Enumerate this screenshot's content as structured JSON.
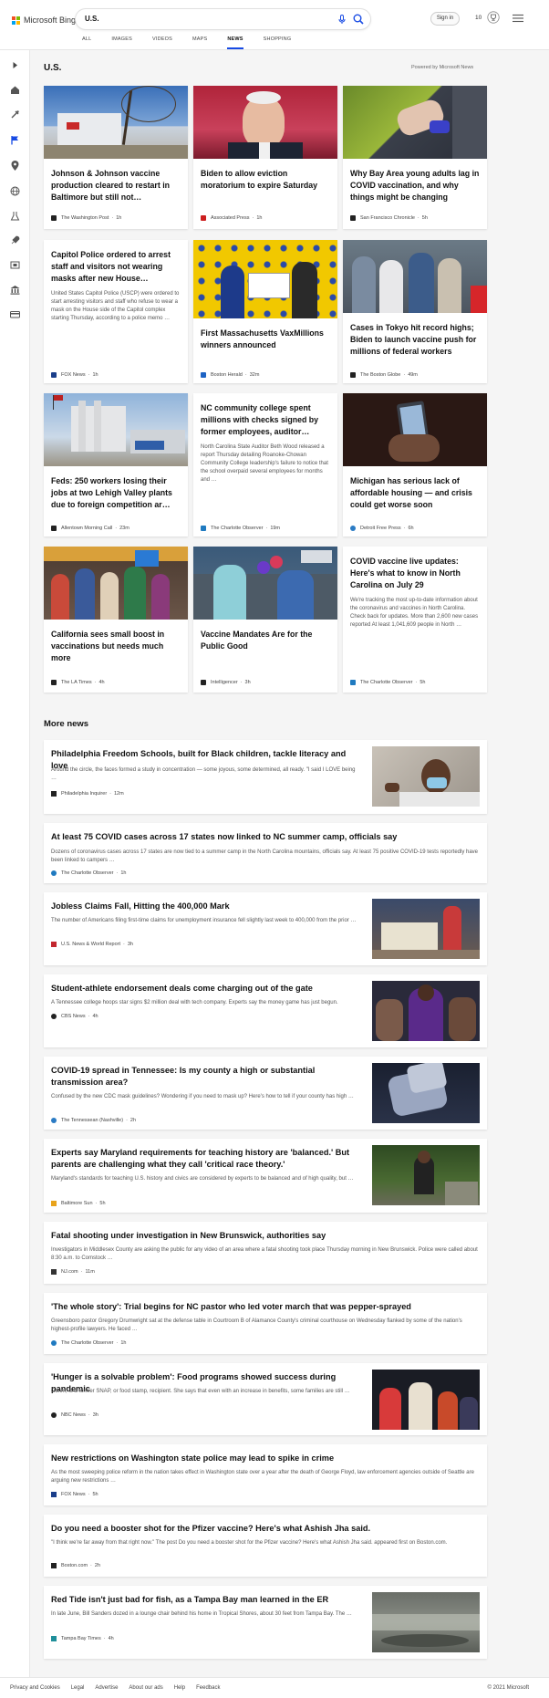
{
  "brand": {
    "name": "Microsoft Bing",
    "logo_colors": [
      "#f25022",
      "#7fba00",
      "#00a4ef",
      "#ffb900"
    ]
  },
  "search": {
    "query": "U.S."
  },
  "header": {
    "signin_label": "Sign in",
    "points": "10"
  },
  "tabs": [
    "ALL",
    "IMAGES",
    "VIDEOS",
    "MAPS",
    "NEWS",
    "SHOPPING"
  ],
  "active_tab": "NEWS",
  "section": {
    "title": "U.S.",
    "powered_by": "Powered by Microsoft News"
  },
  "nav_icons": [
    "expand-arrow-icon",
    "home-icon",
    "tools-icon",
    "flag-icon",
    "location-pin-icon",
    "globe-icon",
    "science-icon",
    "rocket-icon",
    "film-icon",
    "bank-icon",
    "card-icon"
  ],
  "cards": [
    {
      "title": "Johnson & Johnson vaccine production cleared to restart in Baltimore but still not…",
      "snippet": "",
      "source": "The Washington Post",
      "time": "1h",
      "icon_color": "#222222"
    },
    {
      "title": "Biden to allow eviction moratorium to expire Saturday",
      "snippet": "",
      "source": "Associated Press",
      "time": "1h",
      "icon_color": "#cc1f1f"
    },
    {
      "title": "Why Bay Area young adults lag in COVID vaccination, and why things might be changing",
      "snippet": "",
      "source": "San Francisco Chronicle",
      "time": "5h",
      "icon_color": "#222222"
    },
    {
      "title": "Capitol Police ordered to arrest staff and visitors not wearing masks after new House…",
      "snippet": "United States Capitol Police (USCP) were ordered to start arresting visitors and staff who refuse to wear a mask on the House side of the Capitol complex starting Thursday, according to a police memo …",
      "source": "FOX News",
      "time": "1h",
      "icon_color": "#1a3e8a"
    },
    {
      "title": "First Massachusetts VaxMillions winners announced",
      "snippet": "",
      "source": "Boston Herald",
      "time": "32m",
      "icon_color": "#1e63c4"
    },
    {
      "title": "Cases in Tokyo hit record highs; Biden to launch vaccine push for millions of federal workers",
      "snippet": "",
      "source": "The Boston Globe",
      "time": "49m",
      "icon_color": "#222222"
    },
    {
      "title": "Feds: 250 workers losing their jobs at two Lehigh Valley plants due to foreign competition ar…",
      "snippet": "",
      "source": "Allentown Morning Call",
      "time": "23m",
      "icon_color": "#222222"
    },
    {
      "title": "NC community college spent millions with checks signed by former employees, auditor…",
      "snippet": "North Carolina State Auditor Beth Wood released a report Thursday detailing Roanoke-Chowan Community College leadership's failure to notice that the school overpaid several employees for months and …",
      "source": "The Charlotte Observer",
      "time": "19m",
      "icon_color": "#1f7ac0"
    },
    {
      "title": "Michigan has serious lack of affordable housing — and crisis could get worse soon",
      "snippet": "",
      "source": "Detroit Free Press",
      "time": "6h",
      "icon_color": "#2b7bc4"
    },
    {
      "title": "California sees small boost in vaccinations but needs much more",
      "snippet": "",
      "source": "The LA Times",
      "time": "4h",
      "icon_color": "#222222"
    },
    {
      "title": "Vaccine Mandates Are for the Public Good",
      "snippet": "",
      "source": "Intelligencer",
      "time": "3h",
      "icon_color": "#222222"
    },
    {
      "title": "COVID vaccine live updates: Here's what to know in North Carolina on July 29",
      "snippet": "We're tracking the most up-to-date information about the coronavirus and vaccines in North Carolina. Check back for updates. More than 2,600 new cases reported At least 1,041,609 people in North …",
      "source": "The Charlotte Observer",
      "time": "5h",
      "icon_color": "#1f7ac0"
    }
  ],
  "more_news": {
    "title": "More news",
    "items": [
      {
        "title": "Philadelphia Freedom Schools, built for Black children, tackle literacy and love",
        "snippet": "Around the circle, the faces formed a study in concentration — some joyous, some determined, all ready. \"I said I LOVE being …",
        "source": "Philadelphia Inquirer",
        "time": "12m",
        "icon_color": "#222222"
      },
      {
        "title": "At least 75 COVID cases across 17 states now linked to NC summer camp, officials say",
        "snippet": "Dozens of coronavirus cases across 17 states are now tied to a summer camp in the North Carolina mountains, officials say. At least 75 positive COVID-19 tests reportedly have been linked to campers …",
        "source": "The Charlotte Observer",
        "time": "1h",
        "icon_color": "#1f7ac0"
      },
      {
        "title": "Jobless Claims Fall, Hitting the 400,000 Mark",
        "snippet": "The number of Americans filing first-time claims for unemployment insurance fell slightly last week to 400,000 from the prior …",
        "source": "U.S. News & World Report",
        "time": "3h",
        "icon_color": "#c2262e"
      },
      {
        "title": "Student-athlete endorsement deals come charging out of the gate",
        "snippet": "A Tennessee college hoops star signs $2 million deal with tech company. Experts say the money game has just begun.",
        "source": "CBS News",
        "time": "4h",
        "icon_color": "#222222"
      },
      {
        "title": "COVID-19 spread in Tennessee: Is my county a high or substantial transmission area?",
        "snippet": "Confused by the new CDC mask guidelines? Wondering if you need to mask up? Here's how to tell if your county has high …",
        "source": "The Tennessean (Nashville)",
        "time": "2h",
        "icon_color": "#2b7bc4"
      },
      {
        "title": "Experts say Maryland requirements for teaching history are 'balanced.' But parents are challenging what they call 'critical race theory.'",
        "snippet": "Maryland's standards for teaching U.S. history and civics are considered by experts to be balanced and of high quality, but …",
        "source": "Baltimore Sun",
        "time": "5h",
        "icon_color": "#e8a31b"
      },
      {
        "title": "Fatal shooting under investigation in New Brunswick, authorities say",
        "snippet": "Investigators in Middlesex County are asking the public for any video of an area where a fatal shooting took place Thursday morning in New Brunswick. Police were called about 8:30 a.m. to Comstock …",
        "source": "NJ.com",
        "time": "11m",
        "icon_color": "#333333"
      },
      {
        "title": "'The whole story': Trial begins for NC pastor who led voter march that was pepper-sprayed",
        "snippet": "Greensboro pastor Gregory Drumwright sat at the defense table in Courtroom B of Alamance County's criminal courthouse on Wednesday flanked by some of the nation's highest-profile lawyers. He faced …",
        "source": "The Charlotte Observer",
        "time": "1h",
        "icon_color": "#1f7ac0"
      },
      {
        "title": "'Hunger is a solvable problem': Food programs showed success during pandemic",
        "snippet": "Conn., is a former SNAP, or food stamp, recipient. She says that even with an increase in benefits, some families are still …",
        "source": "NBC News",
        "time": "3h",
        "icon_color": "#222222"
      },
      {
        "title": "New restrictions on Washington state police may lead to spike in crime",
        "snippet": "As the most sweeping police reform in the nation takes effect in Washington state over a year after the death of George Floyd, law enforcement agencies outside of Seattle are arguing new restrictions …",
        "source": "FOX News",
        "time": "5h",
        "icon_color": "#1a3e8a"
      },
      {
        "title": "Do you need a booster shot for the Pfizer vaccine? Here's what Ashish Jha said.",
        "snippet": "\"I think we're far away from that right now.\" The post Do you need a booster shot for the Pfizer vaccine? Here's what Ashish Jha said. appeared first on Boston.com.",
        "source": "Boston.com",
        "time": "2h",
        "icon_color": "#222222"
      },
      {
        "title": "Red Tide isn't just bad for fish, as a Tampa Bay man learned in the ER",
        "snippet": "In late June, Bill Sanders dozed in a lounge chair behind his home in Tropical Shores, about 30 feet from Tampa Bay. The …",
        "source": "Tampa Bay Times",
        "time": "4h",
        "icon_color": "#1f8f9a"
      }
    ]
  },
  "footer": {
    "links": [
      "Privacy and Cookies",
      "Legal",
      "Advertise",
      "About our ads",
      "Help",
      "Feedback"
    ],
    "copyright": "© 2021 Microsoft"
  }
}
